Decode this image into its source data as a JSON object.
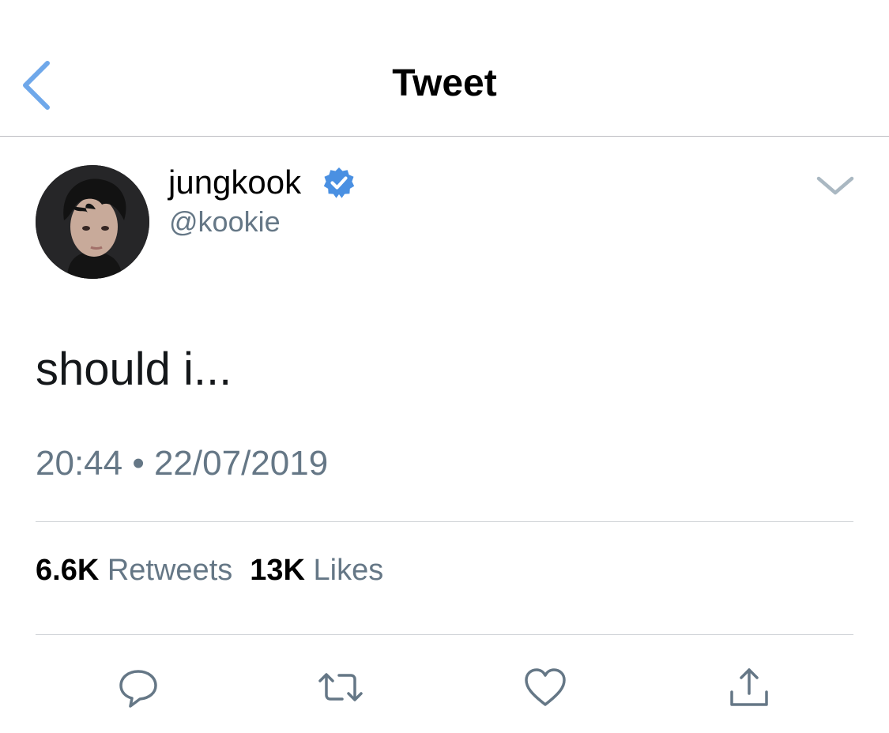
{
  "nav": {
    "title": "Tweet",
    "back_icon": "chevron-left-icon"
  },
  "author": {
    "display_name": "jungkook",
    "handle": "@kookie",
    "verified": true,
    "avatar": "avatar-photo"
  },
  "tweet": {
    "text": "should i...",
    "timestamp": "20:44 • 22/07/2019"
  },
  "stats": {
    "retweets_count": "6.6K",
    "retweets_label": "Retweets",
    "likes_count": "13K",
    "likes_label": "Likes"
  },
  "actions": {
    "reply": "reply-icon",
    "retweet": "retweet-icon",
    "like": "heart-icon",
    "share": "share-icon"
  },
  "colors": {
    "accent": "#4a90e2",
    "verified": "#1da1f2",
    "secondary_text": "#657786",
    "divider": "#cfd2d6",
    "icon": "#657786"
  }
}
